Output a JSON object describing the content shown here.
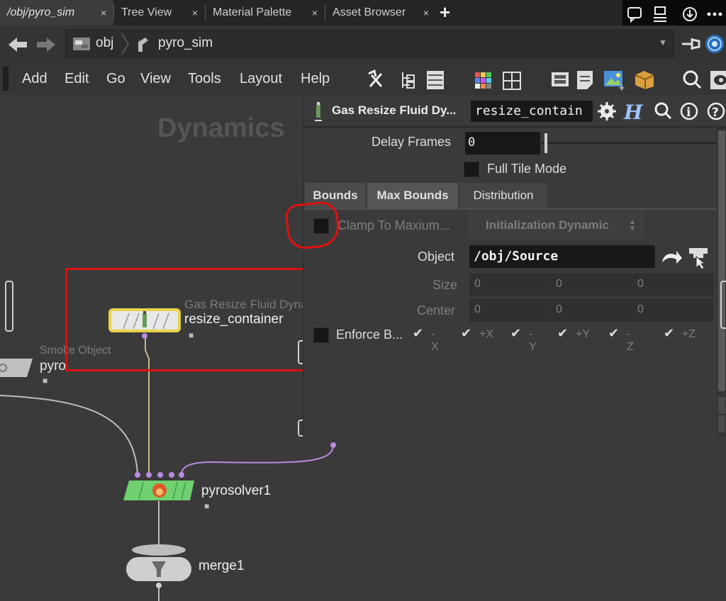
{
  "tabs": [
    {
      "label": "/obj/pyro_sim",
      "close": "×"
    },
    {
      "label": "Tree View",
      "close": "×"
    },
    {
      "label": "Material Palette",
      "close": "×"
    },
    {
      "label": "Asset Browser",
      "close": "×"
    }
  ],
  "add_tab": "+",
  "path": {
    "segments": [
      "obj",
      "pyro_sim"
    ]
  },
  "menu": [
    "Add",
    "Edit",
    "Go",
    "View",
    "Tools",
    "Layout",
    "Help"
  ],
  "network": {
    "watermark": "Dynamics",
    "nodes": {
      "resize": {
        "type": "Gas Resize Fluid Dyna",
        "name": "resize_container"
      },
      "smoke": {
        "type": "Smoke Object",
        "name": "pyro"
      },
      "solver": {
        "name": "pyrosolver1"
      },
      "merge": {
        "name": "merge1"
      }
    }
  },
  "params": {
    "node_type": "Gas Resize Fluid Dy...",
    "node_name": "resize_contain",
    "delay_frames_label": "Delay Frames",
    "delay_frames_value": "0",
    "full_tile_label": "Full Tile Mode",
    "tabs": [
      "Bounds",
      "Max Bounds",
      "Distribution"
    ],
    "clamp_label": "Clamp To Maxium...",
    "init_mode": "Initialization Dynamic",
    "object_label": "Object",
    "object_value": "/obj/Source",
    "size_label": "Size",
    "size_values": [
      "0",
      "0",
      "0"
    ],
    "center_label": "Center",
    "center_values": [
      "0",
      "0",
      "0"
    ],
    "enforce_label": "Enforce B...",
    "axes": [
      "-X",
      "+X",
      "-Y",
      "+Y",
      "-Z",
      "+Z"
    ]
  },
  "colors": {
    "annotation": "#e01010",
    "selected_node": "#e8d24a",
    "solver_node": "#6fd16f",
    "wire_purple": "#b98be0"
  }
}
